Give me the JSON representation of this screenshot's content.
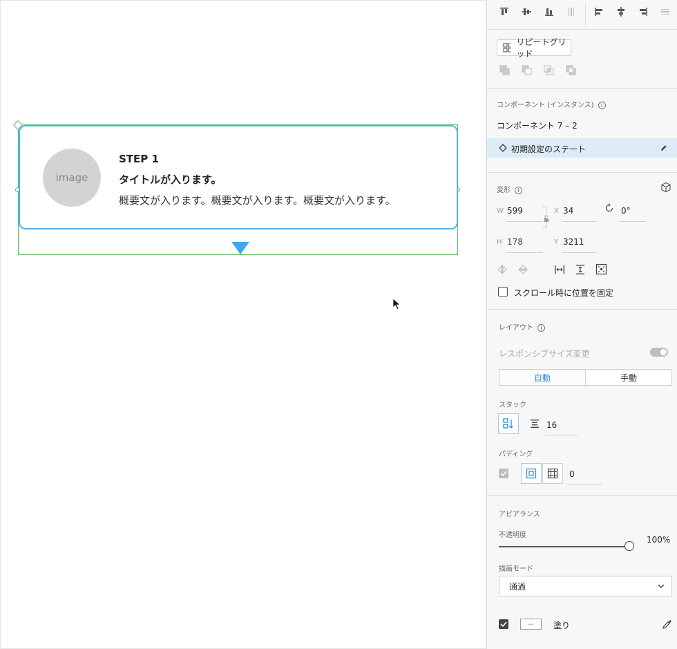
{
  "canvas": {
    "card": {
      "image_label": "image",
      "step": "STEP 1",
      "title": "タイトルが入ります。",
      "description": "概要文が入ります。概要文が入ります。概要文が入ります。"
    }
  },
  "panel": {
    "repeat_grid_label": "リピートグリッド",
    "component": {
      "section_label": "コンポーネント (インスタンス)",
      "name": "コンポーネント 7 – 2",
      "state": "初期設定のステート"
    },
    "transform": {
      "section_label": "変形",
      "w_label": "W",
      "w": "599",
      "x_label": "X",
      "x": "34",
      "rotation": "0°",
      "h_label": "H",
      "h": "178",
      "y_label": "Y",
      "y": "3211",
      "scroll_fix_label": "スクロール時に位置を固定"
    },
    "layout": {
      "section_label": "レイアウト",
      "responsive_label": "レスポンシブサイズ変更",
      "auto_label": "自動",
      "manual_label": "手動",
      "stack_label": "スタック",
      "stack_spacing": "16",
      "padding_label": "パディング",
      "padding_value": "0"
    },
    "appearance": {
      "section_label": "アピアランス",
      "opacity_label": "不透明度",
      "opacity_value": "100%",
      "opacity": 1.0,
      "blend_label": "描画モード",
      "blend_value": "通過",
      "fill_label": "塗り",
      "fill_swatch_text": "--"
    }
  }
}
